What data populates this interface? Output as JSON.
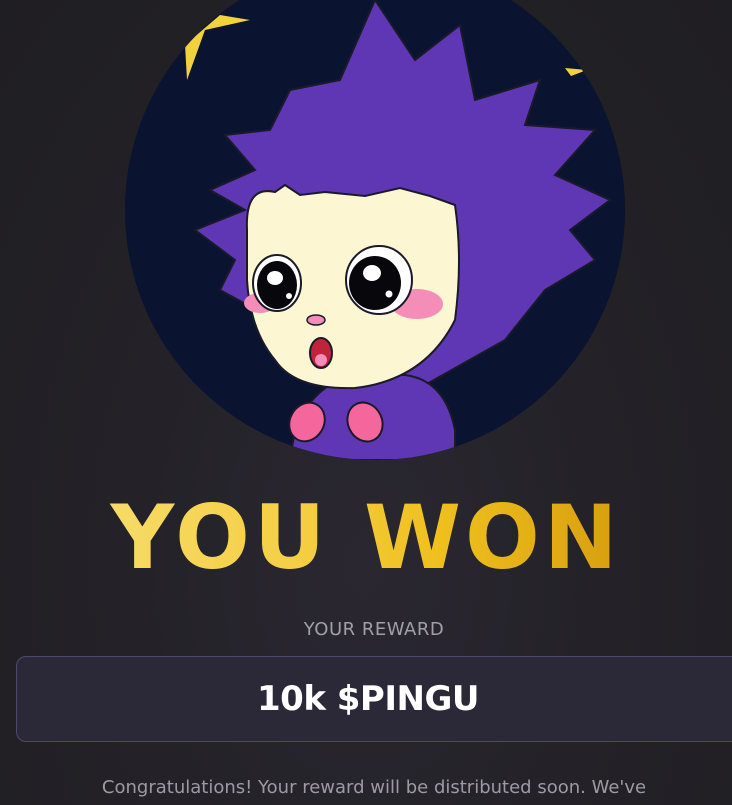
{
  "avatar": {
    "icon": "surprised-purple-mascot-avatar"
  },
  "title": {
    "text": "YOU WON",
    "gradient": [
      "#f7e27a",
      "#efc01d",
      "#c98a08"
    ]
  },
  "reward": {
    "label": "YOUR REWARD",
    "value": "10k $PINGU",
    "border_color": "#4d4670"
  },
  "message": {
    "text": "Congratulations! Your reward will be distributed soon. We've"
  }
}
